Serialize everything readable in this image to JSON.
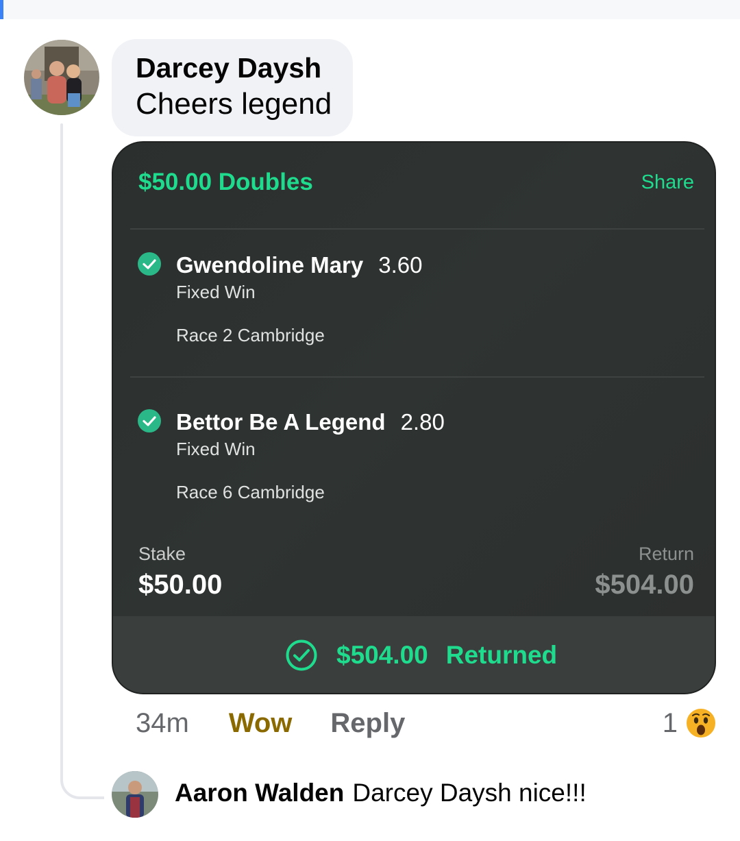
{
  "comment": {
    "author": "Darcey Daysh",
    "text": "Cheers legend"
  },
  "bet": {
    "title": "$50.00 Doubles",
    "share_label": "Share",
    "legs": [
      {
        "runner": "Gwendoline Mary",
        "odds": "3.60",
        "type": "Fixed Win",
        "race": "Race 2 Cambridge",
        "status_icon": "check-circle-icon"
      },
      {
        "runner": "Bettor Be A Legend",
        "odds": "2.80",
        "type": "Fixed Win",
        "race": "Race 6 Cambridge",
        "status_icon": "check-circle-icon"
      }
    ],
    "stake_label": "Stake",
    "stake_value": "$50.00",
    "return_label": "Return",
    "return_value": "$504.00",
    "returned_amount": "$504.00",
    "returned_label": "Returned",
    "accent_color": "#1fdb8e"
  },
  "actions": {
    "time": "34m",
    "reaction_label": "Wow",
    "reply_label": "Reply",
    "reaction_count": "1",
    "reaction_icon": "wow-emoji-icon"
  },
  "reply": {
    "author": "Aaron Walden",
    "text": "Darcey Daysh nice!!!"
  }
}
